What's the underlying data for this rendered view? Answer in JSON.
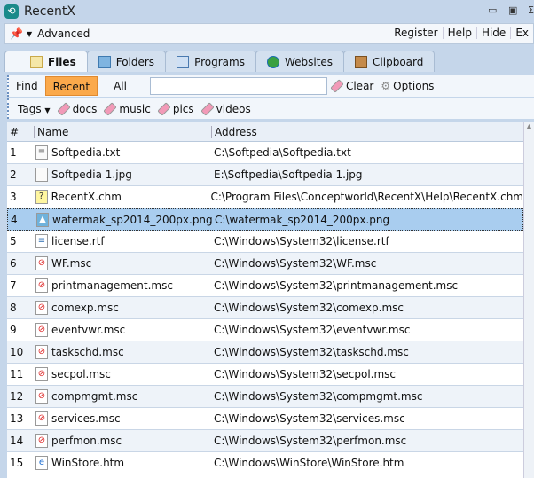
{
  "window": {
    "title": "RecentX"
  },
  "menu": {
    "advanced": "Advanced",
    "register": "Register",
    "help": "Help",
    "hide": "Hide",
    "exit": "Ex"
  },
  "tabs": [
    {
      "label": "Files"
    },
    {
      "label": "Folders"
    },
    {
      "label": "Programs"
    },
    {
      "label": "Websites"
    },
    {
      "label": "Clipboard"
    }
  ],
  "findbar": {
    "find": "Find",
    "recent": "Recent",
    "all": "All",
    "search_value": "",
    "clear": "Clear",
    "options": "Options"
  },
  "tagsbar": {
    "tags": "Tags",
    "items": [
      "docs",
      "music",
      "pics",
      "videos"
    ]
  },
  "table": {
    "columns": [
      "#",
      "Name",
      "Address"
    ],
    "rows": [
      {
        "n": "1",
        "name": "Softpedia.txt",
        "address": "C:\\Softpedia\\Softpedia.txt",
        "icon": "text-file"
      },
      {
        "n": "2",
        "name": "Softpedia 1.jpg",
        "address": "E:\\Softpedia\\Softpedia 1.jpg",
        "icon": "blank-file"
      },
      {
        "n": "3",
        "name": "RecentX.chm",
        "address": "C:\\Program Files\\Conceptworld\\RecentX\\Help\\RecentX.chm",
        "icon": "help-file"
      },
      {
        "n": "4",
        "name": "watermak_sp2014_200px.png",
        "address": "C:\\watermak_sp2014_200px.png",
        "icon": "image-file"
      },
      {
        "n": "5",
        "name": "license.rtf",
        "address": "C:\\Windows\\System32\\license.rtf",
        "icon": "rtf-file"
      },
      {
        "n": "6",
        "name": "WF.msc",
        "address": "C:\\Windows\\System32\\WF.msc",
        "icon": "msc-file"
      },
      {
        "n": "7",
        "name": "printmanagement.msc",
        "address": "C:\\Windows\\System32\\printmanagement.msc",
        "icon": "msc-file"
      },
      {
        "n": "8",
        "name": "comexp.msc",
        "address": "C:\\Windows\\System32\\comexp.msc",
        "icon": "msc-file"
      },
      {
        "n": "9",
        "name": "eventvwr.msc",
        "address": "C:\\Windows\\System32\\eventvwr.msc",
        "icon": "msc-file"
      },
      {
        "n": "10",
        "name": "taskschd.msc",
        "address": "C:\\Windows\\System32\\taskschd.msc",
        "icon": "msc-file"
      },
      {
        "n": "11",
        "name": "secpol.msc",
        "address": "C:\\Windows\\System32\\secpol.msc",
        "icon": "msc-file"
      },
      {
        "n": "12",
        "name": "compmgmt.msc",
        "address": "C:\\Windows\\System32\\compmgmt.msc",
        "icon": "msc-file"
      },
      {
        "n": "13",
        "name": "services.msc",
        "address": "C:\\Windows\\System32\\services.msc",
        "icon": "msc-file"
      },
      {
        "n": "14",
        "name": "perfmon.msc",
        "address": "C:\\Windows\\System32\\perfmon.msc",
        "icon": "msc-file"
      },
      {
        "n": "15",
        "name": "WinStore.htm",
        "address": "C:\\Windows\\WinStore\\WinStore.htm",
        "icon": "html-file"
      }
    ]
  }
}
